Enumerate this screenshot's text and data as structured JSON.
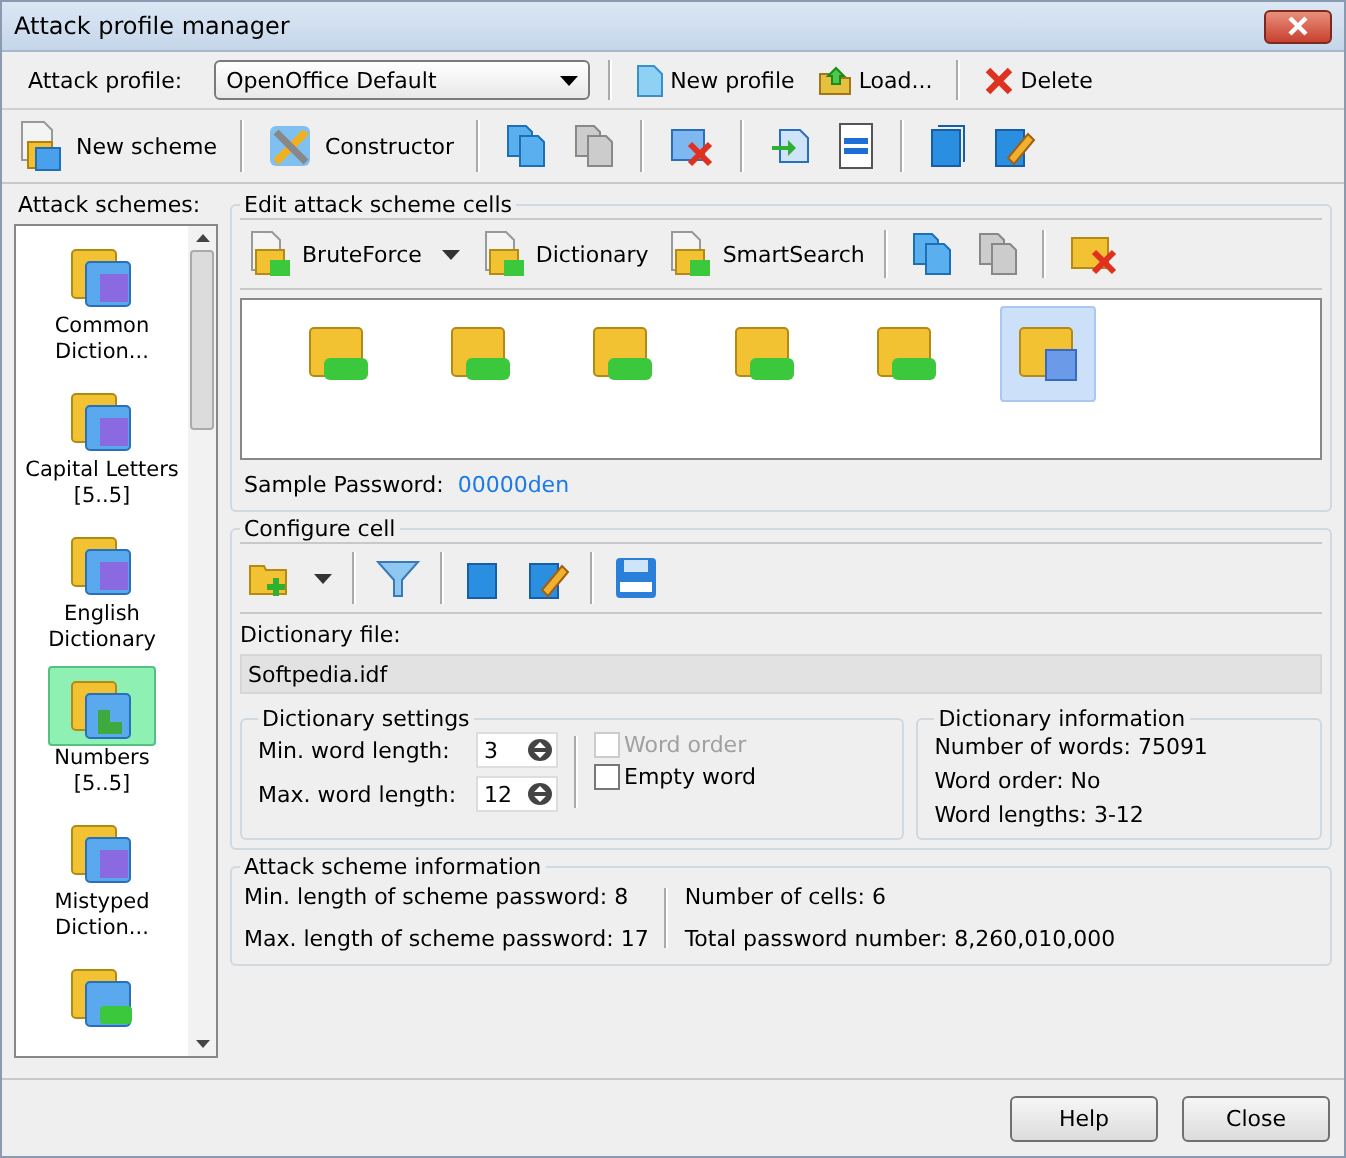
{
  "window": {
    "title": "Attack profile manager"
  },
  "profile_bar": {
    "label": "Attack profile:",
    "value": "OpenOffice Default",
    "buttons": [
      "New profile",
      "Load...",
      "Delete"
    ]
  },
  "toolbar": {
    "buttons": [
      "New scheme",
      "Constructor"
    ]
  },
  "schemes": {
    "label": "Attack schemes:",
    "items": [
      {
        "label": "Common\nDiction...",
        "kind": "dictionary",
        "selected": false
      },
      {
        "label": "Capital Letters\n[5..5]",
        "kind": "dictionary",
        "selected": false
      },
      {
        "label": "English\nDictionary",
        "kind": "dictionary",
        "selected": false
      },
      {
        "label": "Numbers\n[5..5]",
        "kind": "puzzle",
        "selected": true
      },
      {
        "label": "Mistyped\nDiction...",
        "kind": "dictionary",
        "selected": false
      },
      {
        "kind": "bruteforce",
        "selected": false
      }
    ]
  },
  "cells_panel": {
    "title": "Edit attack scheme cells",
    "buttons": [
      "BruteForce",
      "Dictionary",
      "SmartSearch"
    ],
    "cells": [
      {
        "kind": "bruteforce",
        "selected": false
      },
      {
        "kind": "bruteforce",
        "selected": false
      },
      {
        "kind": "bruteforce",
        "selected": false
      },
      {
        "kind": "bruteforce",
        "selected": false
      },
      {
        "kind": "bruteforce",
        "selected": false
      },
      {
        "kind": "dictionary",
        "selected": true
      }
    ],
    "sample_label": "Sample Password:",
    "sample_value": "00000den"
  },
  "configure": {
    "title": "Configure cell",
    "file_label": "Dictionary file:",
    "file_value": "Softpedia.idf",
    "settings": {
      "title": "Dictionary settings",
      "min_label": "Min. word length:",
      "min_value": "3",
      "max_label": "Max. word length:",
      "max_value": "12",
      "options": [
        {
          "label": "Word order",
          "checked": false,
          "disabled": true
        },
        {
          "label": "Empty word",
          "checked": false,
          "disabled": false
        }
      ]
    },
    "info": {
      "title": "Dictionary information",
      "lines": [
        "Number of words: 75091",
        "Word order: No",
        "Word lengths: 3-12"
      ]
    }
  },
  "scheme_info": {
    "title": "Attack scheme information",
    "left": [
      "Min. length of scheme password: 8",
      "Max. length of scheme password: 17"
    ],
    "right": [
      "Number of cells: 6",
      "Total password number: 8,260,010,000"
    ]
  },
  "footer": {
    "buttons": [
      "Help",
      "Close"
    ]
  }
}
